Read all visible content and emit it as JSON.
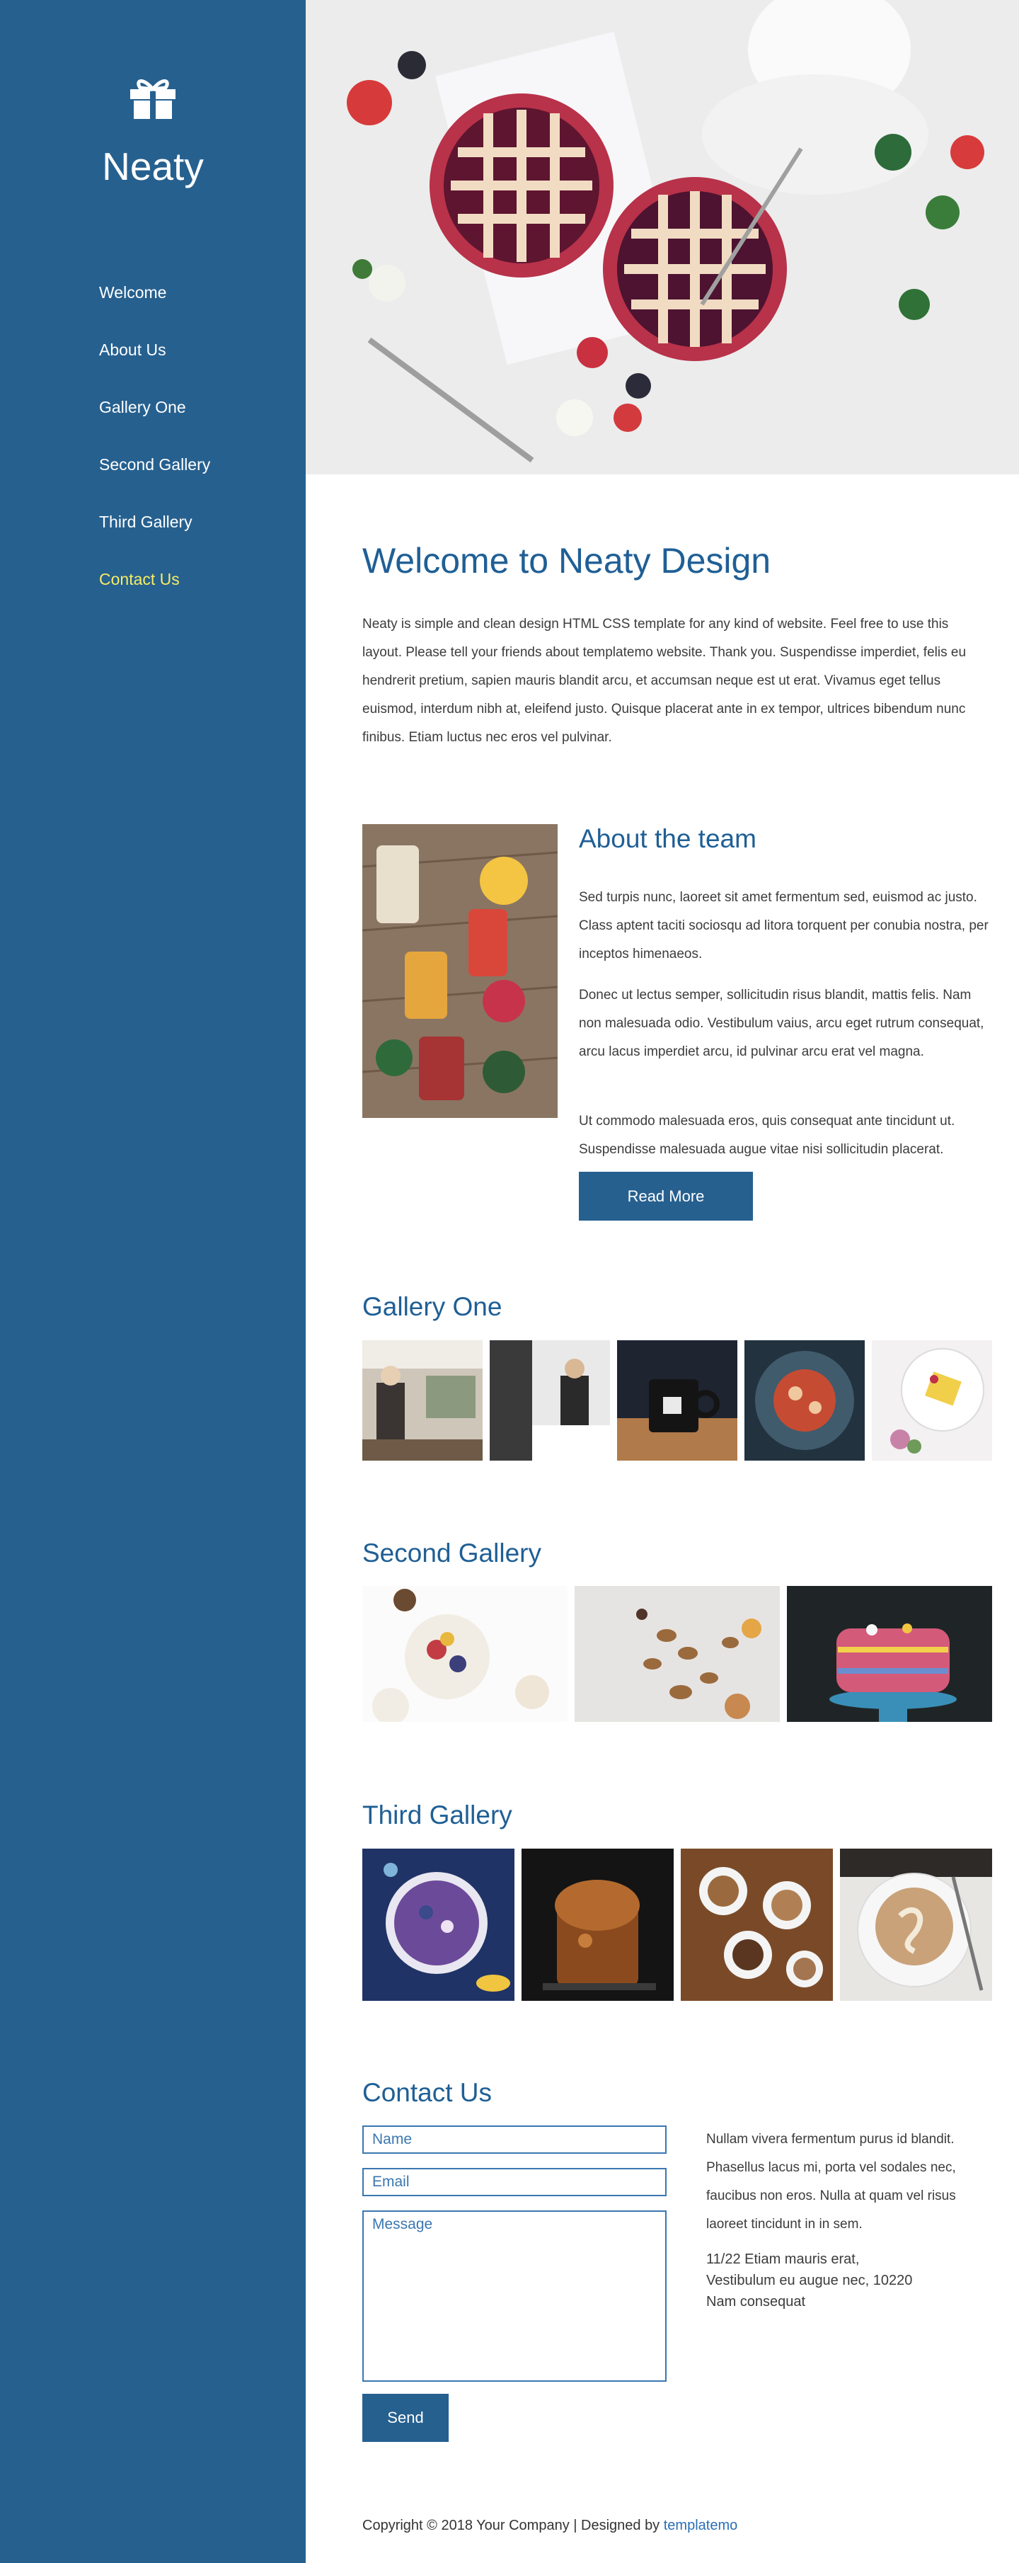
{
  "brand": {
    "name": "Neaty",
    "icon": "gift-icon"
  },
  "nav": {
    "items": [
      "Welcome",
      "About Us",
      "Gallery One",
      "Second Gallery",
      "Third Gallery",
      "Contact Us"
    ],
    "active_index": 5,
    "active_color": "#f7ec63"
  },
  "colors": {
    "sidebar": "#26608f",
    "heading": "#1f5f95",
    "button": "#26608f",
    "link": "#2b6fb3"
  },
  "welcome": {
    "title": "Welcome to Neaty Design",
    "text": "Neaty is simple and clean design HTML CSS template for any kind of website. Feel free to use this layout. Please tell your friends about templatemo website. Thank you. Suspendisse imperdiet, felis eu hendrerit pretium, sapien mauris blandit arcu, et accumsan neque est ut erat. Vivamus eget tellus euismod, interdum nibh at, eleifend justo. Quisque placerat ante in ex tempor, ultrices bibendum nunc finibus. Etiam luctus nec eros vel pulvinar."
  },
  "about": {
    "title": "About the team",
    "paragraphs": [
      "Sed turpis nunc, laoreet sit amet fermentum sed, euismod ac justo. Class aptent taciti sociosqu ad litora torquent per conubia nostra, per inceptos himenaeos.",
      "Donec ut lectus semper, sollicitudin risus blandit, mattis felis. Nam non malesuada odio. Vestibulum vaius, arcu eget rutrum consequat, arcu lacus imperdiet arcu, id pulvinar arcu erat vel magna.",
      "Ut commodo malesuada eros, quis consequat ante tincidunt ut. Suspendisse malesuada augue vitae nisi sollicitudin placerat."
    ],
    "button": "Read More"
  },
  "gallery_one": {
    "title": "Gallery One"
  },
  "gallery_two": {
    "title": "Second Gallery"
  },
  "gallery_three": {
    "title": "Third Gallery"
  },
  "contact": {
    "title": "Contact Us",
    "name_placeholder": "Name",
    "email_placeholder": "Email",
    "message_placeholder": "Message",
    "send": "Send",
    "text": "Nullam vivera fermentum purus id blandit. Phasellus lacus mi, porta vel sodales nec, faucibus non eros. Nulla at quam vel risus laoreet tincidunt in in sem.",
    "address": [
      "11/22 Etiam mauris erat,",
      "Vestibulum eu augue nec, 10220",
      "Nam consequat"
    ]
  },
  "footer": {
    "copyright": "Copyright © 2018 Your Company | Designed by ",
    "link": "templatemo"
  }
}
